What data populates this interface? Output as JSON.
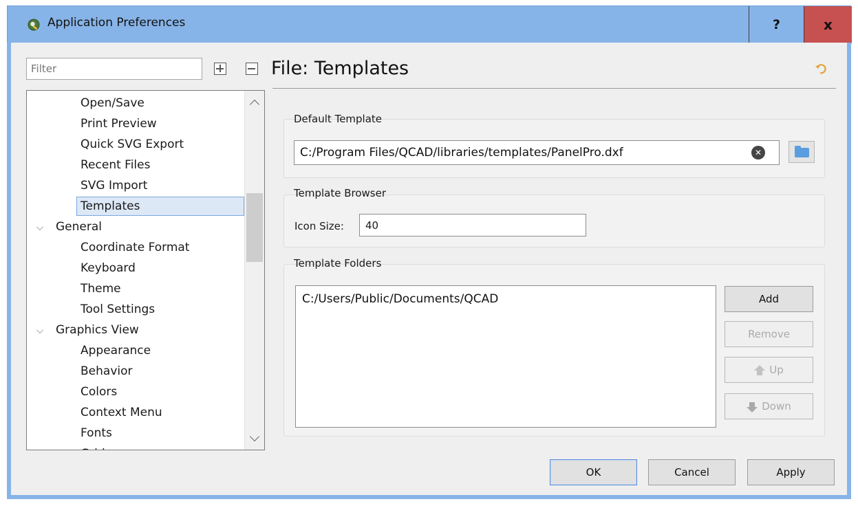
{
  "window": {
    "title": "Application Preferences",
    "help_label": "?",
    "close_label": "x"
  },
  "filter": {
    "placeholder": "Filter"
  },
  "tree": {
    "items": [
      {
        "label": "Open/Save",
        "level": "child"
      },
      {
        "label": "Print Preview",
        "level": "child"
      },
      {
        "label": "Quick SVG Export",
        "level": "child"
      },
      {
        "label": "Recent Files",
        "level": "child"
      },
      {
        "label": "SVG Import",
        "level": "child"
      },
      {
        "label": "Templates",
        "level": "child",
        "selected": true
      },
      {
        "label": "General",
        "level": "parent",
        "expanded": true
      },
      {
        "label": "Coordinate Format",
        "level": "child"
      },
      {
        "label": "Keyboard",
        "level": "child"
      },
      {
        "label": "Theme",
        "level": "child"
      },
      {
        "label": "Tool Settings",
        "level": "child"
      },
      {
        "label": "Graphics View",
        "level": "parent",
        "expanded": true
      },
      {
        "label": "Appearance",
        "level": "child"
      },
      {
        "label": "Behavior",
        "level": "child"
      },
      {
        "label": "Colors",
        "level": "child"
      },
      {
        "label": "Context Menu",
        "level": "child"
      },
      {
        "label": "Fonts",
        "level": "child"
      },
      {
        "label": "Grid",
        "level": "child"
      }
    ]
  },
  "page": {
    "title": "File: Templates"
  },
  "default_template": {
    "group_label": "Default Template",
    "path": "C:/Program Files/QCAD/libraries/templates/PanelPro.dxf"
  },
  "template_browser": {
    "group_label": "Template Browser",
    "icon_size_label": "Icon Size:",
    "icon_size_value": "40"
  },
  "template_folders": {
    "group_label": "Template Folders",
    "folders": [
      "C:/Users/Public/Documents/QCAD"
    ],
    "add_label": "Add",
    "remove_label": "Remove",
    "up_label": "Up",
    "down_label": "Down"
  },
  "dialog_buttons": {
    "ok_label": "OK",
    "cancel_label": "Cancel",
    "apply_label": "Apply"
  },
  "colors": {
    "titlebar": "#87b4e8",
    "close_button": "#c75050",
    "selection": "#dde8f6"
  }
}
